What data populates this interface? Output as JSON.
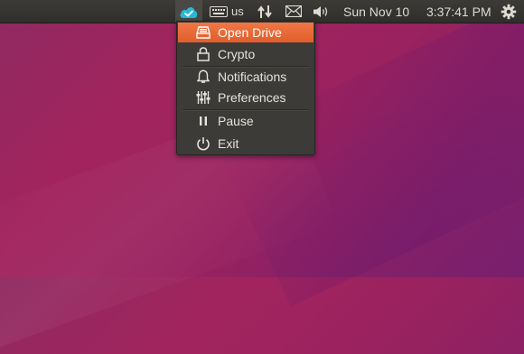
{
  "panel": {
    "keyboard_layout": "us",
    "date": "Sun Nov 10",
    "time": "3:37:41 PM"
  },
  "menu": {
    "items": [
      {
        "label": "Open Drive",
        "icon": "drive-icon"
      },
      {
        "label": "Crypto",
        "icon": "lock-icon"
      },
      {
        "label": "Notifications",
        "icon": "bell-icon"
      },
      {
        "label": "Preferences",
        "icon": "sliders-icon"
      },
      {
        "label": "Pause",
        "icon": "pause-icon"
      },
      {
        "label": "Exit",
        "icon": "power-icon"
      }
    ],
    "highlighted_item": "Open Drive"
  },
  "colors": {
    "panel": "#2f2e2b",
    "menu_bg": "#3c3b37",
    "highlight": "#e8673a",
    "cloud_indicator": "#28b9d8",
    "desktop": "#922660"
  }
}
